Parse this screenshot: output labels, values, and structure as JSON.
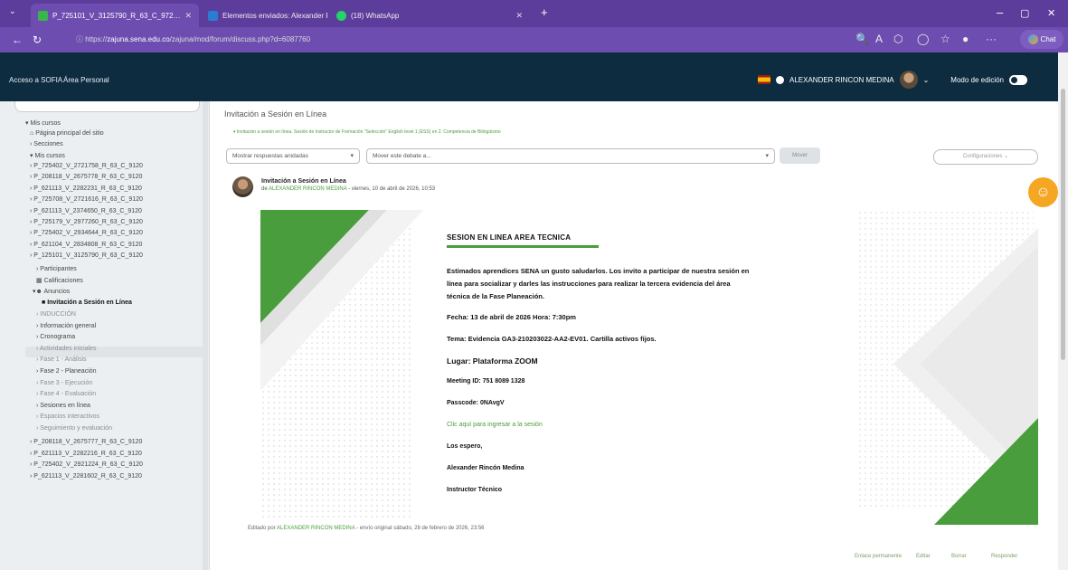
{
  "browser": {
    "tabs": [
      {
        "label": "P_725101_V_3125790_R_63_C_972…"
      },
      {
        "label": "Elementos enviados: Alexander R…"
      },
      {
        "label": "(18) WhatsApp"
      }
    ],
    "url_prefix": "https://",
    "url_domain": "zajuna.sena.edu.co",
    "url_path": "/zajuna/mod/forum/discuss.php?d=6087760",
    "copilot_label": "Chat"
  },
  "header": {
    "link1": "Acceso a SOFIA",
    "link2": "Área Personal",
    "user_name": "ALEXANDER RINCON MEDINA",
    "edit_mode_label": "Modo de edición"
  },
  "sidebar": {
    "mis_cursos": "Mis cursos",
    "pagina_principal": "Página principal del sitio",
    "secciones": "Secciones",
    "mis_cursos2": "Mis cursos",
    "courses_top": [
      "P_725402_V_2721758_R_63_C_9120",
      "P_208118_V_2675778_R_63_C_9120",
      "P_621113_V_2282231_R_63_C_9120",
      "P_725708_V_2721616_R_63_C_9120",
      "P_621113_V_2374650_R_63_C_9120",
      "P_725179_V_2977260_R_63_C_9120",
      "P_725402_V_2934644_R_63_C_9120",
      "P_621104_V_2834808_R_63_C_9120",
      "P_125101_V_3125790_R_63_C_9120"
    ],
    "participantes": "Participantes",
    "calificaciones": "Calificaciones",
    "anuncios": "Anuncios",
    "current": "Invitación a Sesión en Línea",
    "sections": [
      "INDUCCIÓN",
      "Información general",
      "Cronograma",
      "Actividades iniciales",
      "Fase 1 - Análisis",
      "Fase 2 - Planeación",
      "Fase 3 - Ejecución",
      "Fase 4 - Evaluación",
      "Sesiones en línea",
      "Espacios interactivos",
      "Seguimiento y evaluación"
    ],
    "courses_bottom": [
      "P_208118_V_2675777_R_63_C_9120",
      "P_621113_V_2282216_R_63_C_9120",
      "P_725402_V_2921224_R_63_C_9120",
      "P_621113_V_2281602_R_63_C_9120"
    ]
  },
  "main": {
    "page_title": "Invitación a Sesión en Línea",
    "breadcrumb": "▾ Invitación a sesión en línea. Sesión de Instructor de Formación \"Selección\" English level 1 (ESS) en 2. Competencia de Bilingüismo",
    "display_select": "Mostrar respuestas anidadas",
    "move_select": "Mover este debate a...",
    "move_button": "Mover",
    "config_button": "Configuraciones",
    "post_title": "Invitación a Sesión en Línea",
    "post_by": "de",
    "post_author": "ALEXANDER RINCON MEDINA",
    "post_date": "- viernes, 10 de abril de 2026, 10:53",
    "flyer": {
      "title": "SESION EN LINEA AREA TECNICA",
      "para": "Estimados aprendices SENA un gusto saludarlos. Los invito a participar de nuestra sesión en línea para socializar y darles las instrucciones para realizar la tercera evidencia del área técnica de la Fase Planeación.",
      "fecha": "Fecha: 13 de abril de 2026      Hora: 7:30pm",
      "tema": "Tema: Evidencia GA3-210203022-AA2-EV01. Cartilla activos fijos.",
      "lugar": "Lugar: Plataforma ZOOM",
      "meeting": "Meeting ID: 751 8089 1328",
      "passcode": "Passcode: 0NAvgV",
      "link": "Clic aquí para ingresar a la sesión",
      "los_espero": "Los espero,",
      "firma": "Alexander Rincón Medina",
      "cargo": "Instructor Técnico"
    },
    "edit_prefix": "Editado por",
    "edit_author": "ALEXANDER RINCON MEDINA",
    "edit_suffix": "- envío original sábado, 28 de febrero de 2026, 23:56",
    "actions": [
      "Enlace permanente",
      "Editar",
      "Borrar",
      "Responder"
    ]
  },
  "colors": {
    "accent_green": "#4a9d3c",
    "header_navy": "#0d2c40",
    "browser_purple": "#5d3d9c"
  }
}
